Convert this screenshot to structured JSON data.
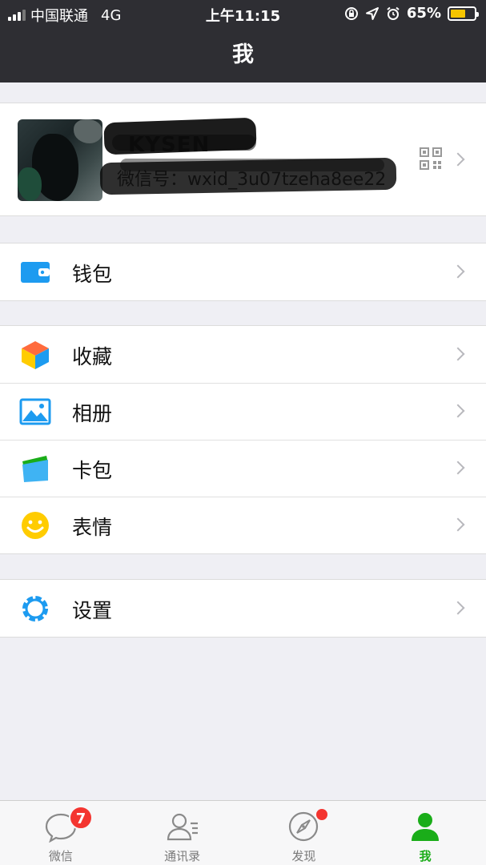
{
  "status_bar": {
    "carrier": "中国联通",
    "network": "4G",
    "time": "上午11:15",
    "battery_percent": "65%",
    "battery_level": 0.65
  },
  "nav": {
    "title": "我"
  },
  "profile": {
    "nickname": "KYSEN",
    "wechat_id": "微信号：wxid_3u07tzeha8ee22"
  },
  "menu": {
    "wallet": "钱包",
    "favorites": "收藏",
    "album": "相册",
    "cards": "卡包",
    "stickers": "表情",
    "settings": "设置"
  },
  "tabs": [
    {
      "label": "微信",
      "badge": "7"
    },
    {
      "label": "通讯录"
    },
    {
      "label": "发现"
    },
    {
      "label": "我"
    }
  ],
  "colors": {
    "accent_green": "#1aad19",
    "badge_red": "#f43530",
    "icon_blue": "#1d9bf0",
    "nav_bg": "#2e2e33"
  }
}
